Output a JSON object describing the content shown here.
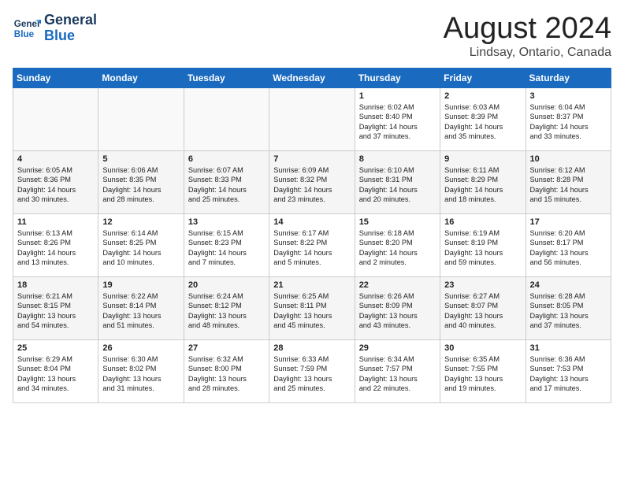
{
  "logo": {
    "line1": "General",
    "line2": "Blue"
  },
  "title": "August 2024",
  "subtitle": "Lindsay, Ontario, Canada",
  "days_of_week": [
    "Sunday",
    "Monday",
    "Tuesday",
    "Wednesday",
    "Thursday",
    "Friday",
    "Saturday"
  ],
  "weeks": [
    [
      {
        "day": "",
        "info": ""
      },
      {
        "day": "",
        "info": ""
      },
      {
        "day": "",
        "info": ""
      },
      {
        "day": "",
        "info": ""
      },
      {
        "day": "1",
        "info": "Sunrise: 6:02 AM\nSunset: 8:40 PM\nDaylight: 14 hours\nand 37 minutes."
      },
      {
        "day": "2",
        "info": "Sunrise: 6:03 AM\nSunset: 8:39 PM\nDaylight: 14 hours\nand 35 minutes."
      },
      {
        "day": "3",
        "info": "Sunrise: 6:04 AM\nSunset: 8:37 PM\nDaylight: 14 hours\nand 33 minutes."
      }
    ],
    [
      {
        "day": "4",
        "info": "Sunrise: 6:05 AM\nSunset: 8:36 PM\nDaylight: 14 hours\nand 30 minutes."
      },
      {
        "day": "5",
        "info": "Sunrise: 6:06 AM\nSunset: 8:35 PM\nDaylight: 14 hours\nand 28 minutes."
      },
      {
        "day": "6",
        "info": "Sunrise: 6:07 AM\nSunset: 8:33 PM\nDaylight: 14 hours\nand 25 minutes."
      },
      {
        "day": "7",
        "info": "Sunrise: 6:09 AM\nSunset: 8:32 PM\nDaylight: 14 hours\nand 23 minutes."
      },
      {
        "day": "8",
        "info": "Sunrise: 6:10 AM\nSunset: 8:31 PM\nDaylight: 14 hours\nand 20 minutes."
      },
      {
        "day": "9",
        "info": "Sunrise: 6:11 AM\nSunset: 8:29 PM\nDaylight: 14 hours\nand 18 minutes."
      },
      {
        "day": "10",
        "info": "Sunrise: 6:12 AM\nSunset: 8:28 PM\nDaylight: 14 hours\nand 15 minutes."
      }
    ],
    [
      {
        "day": "11",
        "info": "Sunrise: 6:13 AM\nSunset: 8:26 PM\nDaylight: 14 hours\nand 13 minutes."
      },
      {
        "day": "12",
        "info": "Sunrise: 6:14 AM\nSunset: 8:25 PM\nDaylight: 14 hours\nand 10 minutes."
      },
      {
        "day": "13",
        "info": "Sunrise: 6:15 AM\nSunset: 8:23 PM\nDaylight: 14 hours\nand 7 minutes."
      },
      {
        "day": "14",
        "info": "Sunrise: 6:17 AM\nSunset: 8:22 PM\nDaylight: 14 hours\nand 5 minutes."
      },
      {
        "day": "15",
        "info": "Sunrise: 6:18 AM\nSunset: 8:20 PM\nDaylight: 14 hours\nand 2 minutes."
      },
      {
        "day": "16",
        "info": "Sunrise: 6:19 AM\nSunset: 8:19 PM\nDaylight: 13 hours\nand 59 minutes."
      },
      {
        "day": "17",
        "info": "Sunrise: 6:20 AM\nSunset: 8:17 PM\nDaylight: 13 hours\nand 56 minutes."
      }
    ],
    [
      {
        "day": "18",
        "info": "Sunrise: 6:21 AM\nSunset: 8:15 PM\nDaylight: 13 hours\nand 54 minutes."
      },
      {
        "day": "19",
        "info": "Sunrise: 6:22 AM\nSunset: 8:14 PM\nDaylight: 13 hours\nand 51 minutes."
      },
      {
        "day": "20",
        "info": "Sunrise: 6:24 AM\nSunset: 8:12 PM\nDaylight: 13 hours\nand 48 minutes."
      },
      {
        "day": "21",
        "info": "Sunrise: 6:25 AM\nSunset: 8:11 PM\nDaylight: 13 hours\nand 45 minutes."
      },
      {
        "day": "22",
        "info": "Sunrise: 6:26 AM\nSunset: 8:09 PM\nDaylight: 13 hours\nand 43 minutes."
      },
      {
        "day": "23",
        "info": "Sunrise: 6:27 AM\nSunset: 8:07 PM\nDaylight: 13 hours\nand 40 minutes."
      },
      {
        "day": "24",
        "info": "Sunrise: 6:28 AM\nSunset: 8:05 PM\nDaylight: 13 hours\nand 37 minutes."
      }
    ],
    [
      {
        "day": "25",
        "info": "Sunrise: 6:29 AM\nSunset: 8:04 PM\nDaylight: 13 hours\nand 34 minutes."
      },
      {
        "day": "26",
        "info": "Sunrise: 6:30 AM\nSunset: 8:02 PM\nDaylight: 13 hours\nand 31 minutes."
      },
      {
        "day": "27",
        "info": "Sunrise: 6:32 AM\nSunset: 8:00 PM\nDaylight: 13 hours\nand 28 minutes."
      },
      {
        "day": "28",
        "info": "Sunrise: 6:33 AM\nSunset: 7:59 PM\nDaylight: 13 hours\nand 25 minutes."
      },
      {
        "day": "29",
        "info": "Sunrise: 6:34 AM\nSunset: 7:57 PM\nDaylight: 13 hours\nand 22 minutes."
      },
      {
        "day": "30",
        "info": "Sunrise: 6:35 AM\nSunset: 7:55 PM\nDaylight: 13 hours\nand 19 minutes."
      },
      {
        "day": "31",
        "info": "Sunrise: 6:36 AM\nSunset: 7:53 PM\nDaylight: 13 hours\nand 17 minutes."
      }
    ]
  ]
}
